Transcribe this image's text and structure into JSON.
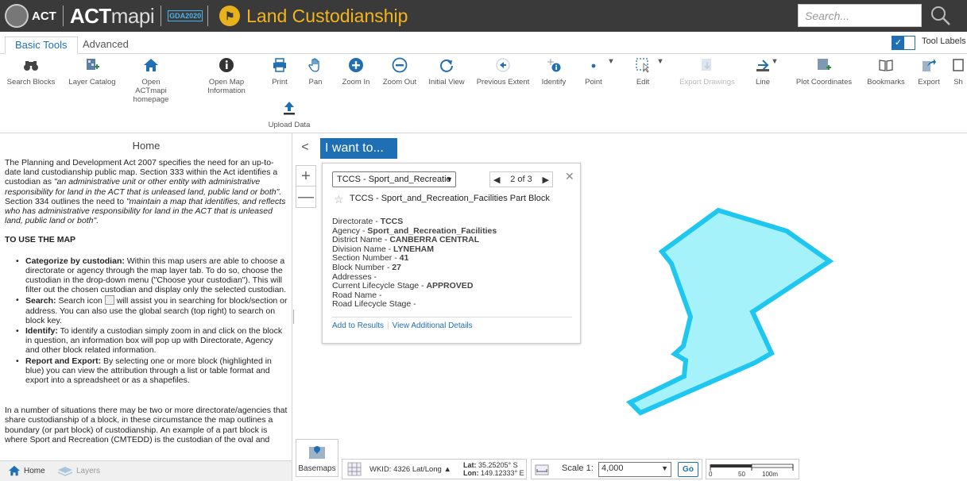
{
  "header": {
    "act_label": "ACT",
    "brand_bold": "ACT",
    "brand_light": "mapi",
    "gda_label": "GDA2020",
    "app_title": "Land Custodianship",
    "search_placeholder": "Search..."
  },
  "tabs": {
    "basic": "Basic Tools",
    "advanced": "Advanced",
    "tool_labels": "Tool Labels"
  },
  "toolbar": {
    "search_blocks": "Search Blocks",
    "layer_catalog": "Layer Catalog",
    "open_homepage": "Open ACTmapi homepage",
    "open_map_info": "Open Map Information",
    "print": "Print",
    "pan": "Pan",
    "zoom_in": "Zoom In",
    "zoom_out": "Zoom Out",
    "initial_view": "Initial View",
    "previous_extent": "Previous Extent",
    "identify": "Identify",
    "point": "Point",
    "edit": "Edit",
    "export_drawings": "Export Drawings",
    "line": "Line",
    "plot_coordinates": "Plot Coordinates",
    "bookmarks": "Bookmarks",
    "export": "Export",
    "share": "Sh",
    "upload_data": "Upload Data"
  },
  "left_panel": {
    "title": "Home",
    "intro_1": "The Planning and Development Act 2007 specifies the need for an up-to-date land custodianship public map. Section 333 within the Act identifies a custodian as ",
    "intro_quote_1": "\"an administrative unit or other entity with administrative responsibility for land in the ACT that is unleased land, public land or both\".",
    "intro_2": " Section 334 outlines the need to ",
    "intro_quote_2": "\"maintain a map that identifies, and reflects who has administrative responsibility for land in the ACT that is unleased land, public land or both\".",
    "how_to_heading": "TO USE THE MAP",
    "items": [
      {
        "label": "Categorize by custodian:",
        "text": " Within this map users are able to choose a directorate or agency through the map layer tab. To do so, choose the custodian in the drop-down menu (\"Choose your custodian\"). This will filter out the chosen custodian and display only the selected custodian."
      },
      {
        "label": "Search:",
        "text_a": " Search icon ",
        "text_b": " will assist you in searching for block/section or address.  You can also use the global search (top right) to search on block key."
      },
      {
        "label": "Identify:",
        "text": " To identify a custodian simply zoom in and click on the block in question, an information box will pop up with Directorate, Agency and other block related information."
      },
      {
        "label": "Report and Export:",
        "text": " By selecting one or more block (highlighted in blue) you can view the attribution through a list or table format and export into a spreadsheet or as a shapefiles."
      }
    ],
    "outro": "In a number of situations there may be two or more directorate/agencies that share custodianship of a block, in these circumstance the map outlines a boundary (or part block) of custodianship.  An example of a part block is where Sport and Recreation (CMTEDD) is the custodian of the oval and",
    "tab_home": "Home",
    "tab_layers": "Layers"
  },
  "map": {
    "i_want_to": "I want to...",
    "zoom_plus": "+",
    "zoom_minus": "—",
    "collapse": "<"
  },
  "popup": {
    "layer_select": "TCCS - Sport_and_Recreatio",
    "pager": "2 of 3",
    "close": "✕",
    "title": "TCCS - Sport_and_Recreation_Facilities Part Block",
    "attrs": [
      {
        "key": "Directorate - ",
        "val": "TCCS"
      },
      {
        "key": "Agency - ",
        "val": "Sport_and_Recreation_Facilities"
      },
      {
        "key": "District Name - ",
        "val": "CANBERRA CENTRAL"
      },
      {
        "key": "Division Name - ",
        "val": "LYNEHAM"
      },
      {
        "key": "Section Number - ",
        "val": "41"
      },
      {
        "key": "Block Number - ",
        "val": "27"
      },
      {
        "key": "Addresses - ",
        "val": ""
      },
      {
        "key": "Current Lifecycle Stage - ",
        "val": "APPROVED"
      },
      {
        "key": "Road Name - ",
        "val": ""
      },
      {
        "key": "Road Lifecycle Stage - ",
        "val": ""
      }
    ],
    "add_to_results": "Add to Results",
    "view_details": "View Additional Details"
  },
  "statusbar": {
    "basemaps": "Basemaps",
    "wkid": "WKID: 4326 Lat/Long ▲",
    "lat_label": "Lat:",
    "lat_value": "35.25205° S",
    "lon_label": "Lon:",
    "lon_value": "149.12333° E",
    "scale_label": "Scale 1:",
    "scale_value": "4,000",
    "go": "Go",
    "rule_0": "0",
    "rule_50": "50",
    "rule_100": "100m"
  },
  "colors": {
    "accent": "#1f6fb4",
    "title": "#f3b51b",
    "parcel_fill": "#a6f2fb",
    "parcel_stroke": "#1fc7f0"
  }
}
